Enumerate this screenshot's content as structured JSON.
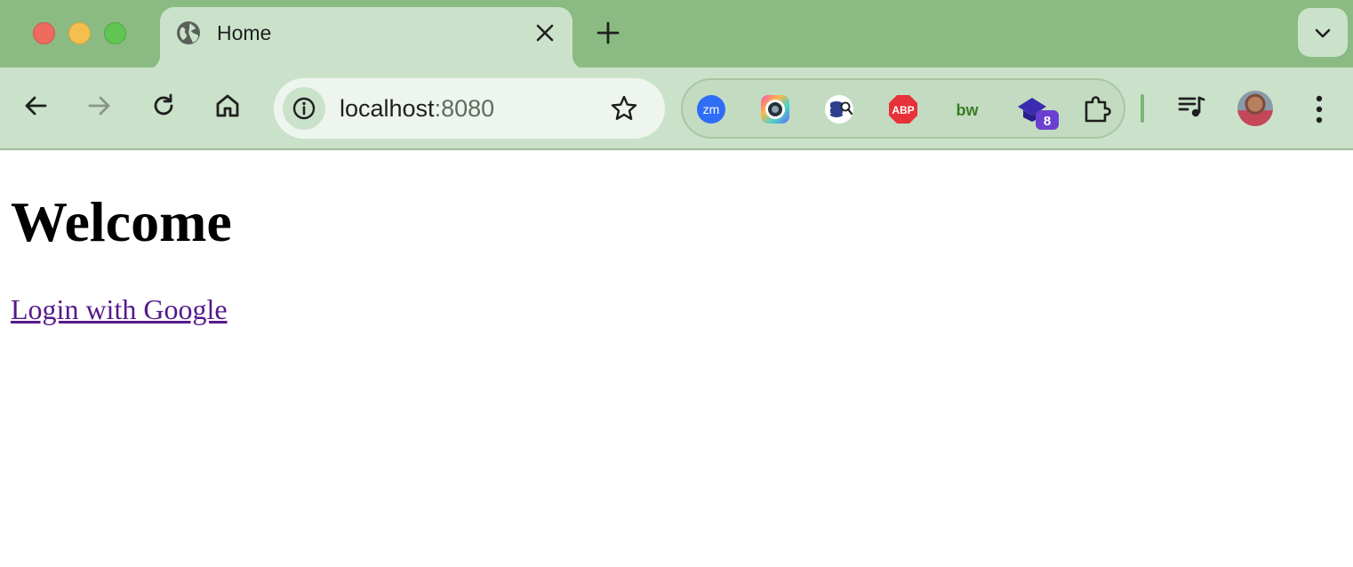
{
  "browser": {
    "tab": {
      "title": "Home",
      "favicon": "globe-icon"
    },
    "address_bar": {
      "host": "localhost",
      "port": ":8080"
    },
    "extensions": [
      {
        "name": "zoom-extension-icon",
        "label": "zm"
      },
      {
        "name": "camera-extension-icon",
        "label": ""
      },
      {
        "name": "database-search-extension-icon",
        "label": ""
      },
      {
        "name": "adblock-plus-extension-icon",
        "label": "ABP"
      },
      {
        "name": "bw-extension-icon",
        "label": "bw"
      },
      {
        "name": "graduation-cap-extension-icon",
        "label": "",
        "badge": "8"
      },
      {
        "name": "puzzle-extensions-icon",
        "label": ""
      }
    ],
    "colors": {
      "tabstrip": "#8bbb82",
      "toolbar": "#cbe2ca",
      "link_visited": "#551a8b"
    }
  },
  "page": {
    "heading": "Welcome",
    "login_link": "Login with Google"
  }
}
